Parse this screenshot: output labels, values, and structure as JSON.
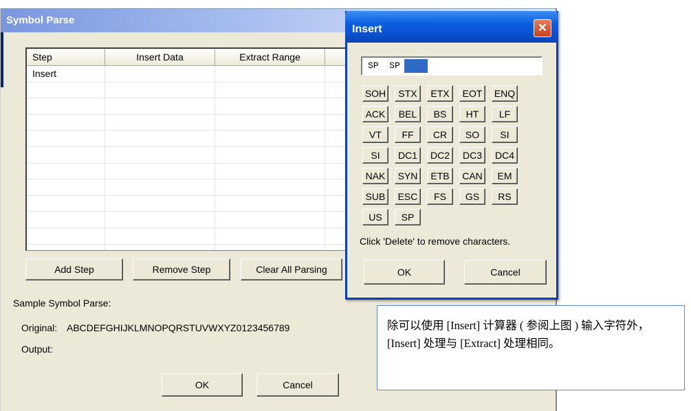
{
  "main_window": {
    "title": "Symbol Parse",
    "columns": [
      "Step",
      "Insert Data",
      "Extract Range",
      ""
    ],
    "rows": [
      [
        "Insert",
        "",
        "",
        ""
      ],
      [
        "",
        "",
        "",
        ""
      ],
      [
        "",
        "",
        "",
        ""
      ],
      [
        "",
        "",
        "",
        ""
      ],
      [
        "",
        "",
        "",
        ""
      ],
      [
        "",
        "",
        "",
        ""
      ],
      [
        "",
        "",
        "",
        ""
      ],
      [
        "",
        "",
        "",
        ""
      ],
      [
        "",
        "",
        "",
        ""
      ],
      [
        "",
        "",
        "",
        ""
      ],
      [
        "",
        "",
        "",
        ""
      ],
      [
        "",
        "",
        "",
        ""
      ]
    ],
    "add_step_label": "Add Step",
    "remove_step_label": "Remove Step",
    "clear_all_label": "Clear All Parsing",
    "sample_label": "Sample Symbol Parse:",
    "original_label": "Original:",
    "original_value": "ABCDEFGHIJKLMNOPQRSTUVWXYZ0123456789",
    "output_label": "Output:",
    "ok_label": "OK",
    "cancel_label": "Cancel"
  },
  "insert_window": {
    "title": "Insert",
    "close_glyph": "✕",
    "input_value": "SP  SP",
    "chars": [
      "SOH",
      "STX",
      "ETX",
      "EOT",
      "ENQ",
      "ACK",
      "BEL",
      "BS",
      "HT",
      "LF",
      "VT",
      "FF",
      "CR",
      "SO",
      "SI",
      "SI",
      "DC1",
      "DC2",
      "DC3",
      "DC4",
      "NAK",
      "SYN",
      "ETB",
      "CAN",
      "EM",
      "SUB",
      "ESC",
      "FS",
      "GS",
      "RS",
      "US",
      "SP"
    ],
    "hint": "Click 'Delete' to remove characters.",
    "ok_label": "OK",
    "cancel_label": "Cancel"
  },
  "note": {
    "text": "除可以使用 [Insert] 计算器 ( 参阅上图 ) 输入字符外， [Insert] 处理与 [Extract] 处理相同。"
  },
  "colors": {
    "dialog_face": "#ece9d8",
    "insert_title": "#0a5fe0",
    "caret": "#3169c6"
  }
}
